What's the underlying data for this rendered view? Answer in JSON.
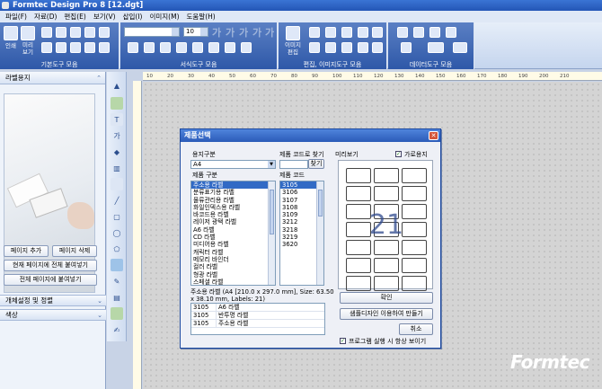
{
  "window": {
    "title": "Formtec Design Pro 8 [12.dgt]"
  },
  "menu": [
    "파일(F)",
    "자료(D)",
    "편집(E)",
    "보기(V)",
    "삽입(I)",
    "이미지(M)",
    "도움말(H)"
  ],
  "ribbon": {
    "groups": [
      "기본도구 모음",
      "서식도구 모음",
      "편집, 이미지도구 모음",
      "데이터도구 모음"
    ],
    "print_label": "인쇄",
    "preview_label": "미리\n보기",
    "font_size": "10",
    "image_edit_label": "이미지\n편집"
  },
  "left_panel": {
    "header": "라벨용지",
    "buttons": [
      "페이지 추가",
      "페이지 삭제",
      "현재 페이지에 전체 붙여넣기",
      "전체 페이지에 붙여넣기"
    ],
    "sections": [
      "개체설정 및 정렬",
      "색상"
    ]
  },
  "dialog": {
    "title": "제품선택",
    "paper_type_label": "용지구분",
    "paper_type_value": "A4",
    "code_search_label": "제품 코드로 찾기",
    "search_button": "찾기",
    "preview_label": "미리보기",
    "landscape_label": "가로용지",
    "category_label": "제품 구분",
    "code_label": "제품 코드",
    "categories": [
      "주소용 라벨",
      "분류표기용 라벨",
      "물류관리용 라벨",
      "화일인덱스용 라벨",
      "바코드용 라벨",
      "레이저 광택 라벨",
      "A6 라벨",
      "CD 라벨",
      "미디어용 라벨",
      "캐릭터 라벨",
      "메모리 바인더",
      "컬러 라벨",
      "형광 라벨",
      "스페셜 라벨"
    ],
    "codes": [
      "3105",
      "3106",
      "3107",
      "3108",
      "3109",
      "3212",
      "3218",
      "3219",
      "3620"
    ],
    "preview_count": "21",
    "info": "주소용 라벨 (A4 [210.0 x 297.0 mm], Size: 63.50 x 38.10 mm, Labels: 21)",
    "table": [
      {
        "code": "3105",
        "name": "A6 라벨"
      },
      {
        "code": "3105",
        "name": "반투명 라벨"
      },
      {
        "code": "3105",
        "name": "주소용 라벨"
      }
    ],
    "ok_button": "확인",
    "sample_button": "샘플디자인 이용하여 만들기",
    "cancel_button": "취소",
    "startup_check_label": "프로그램 실행 시 항상 보이기"
  },
  "ruler": {
    "ticks": [
      "10",
      "20",
      "30",
      "40",
      "50",
      "60",
      "70",
      "80",
      "90",
      "100",
      "110",
      "120",
      "130",
      "140",
      "150",
      "160",
      "170",
      "180",
      "190",
      "200",
      "210"
    ]
  },
  "watermark": "Formtec",
  "colors": {
    "accent": "#2e58a8",
    "selection": "#316ac5",
    "title_bar": "#2456b6"
  }
}
